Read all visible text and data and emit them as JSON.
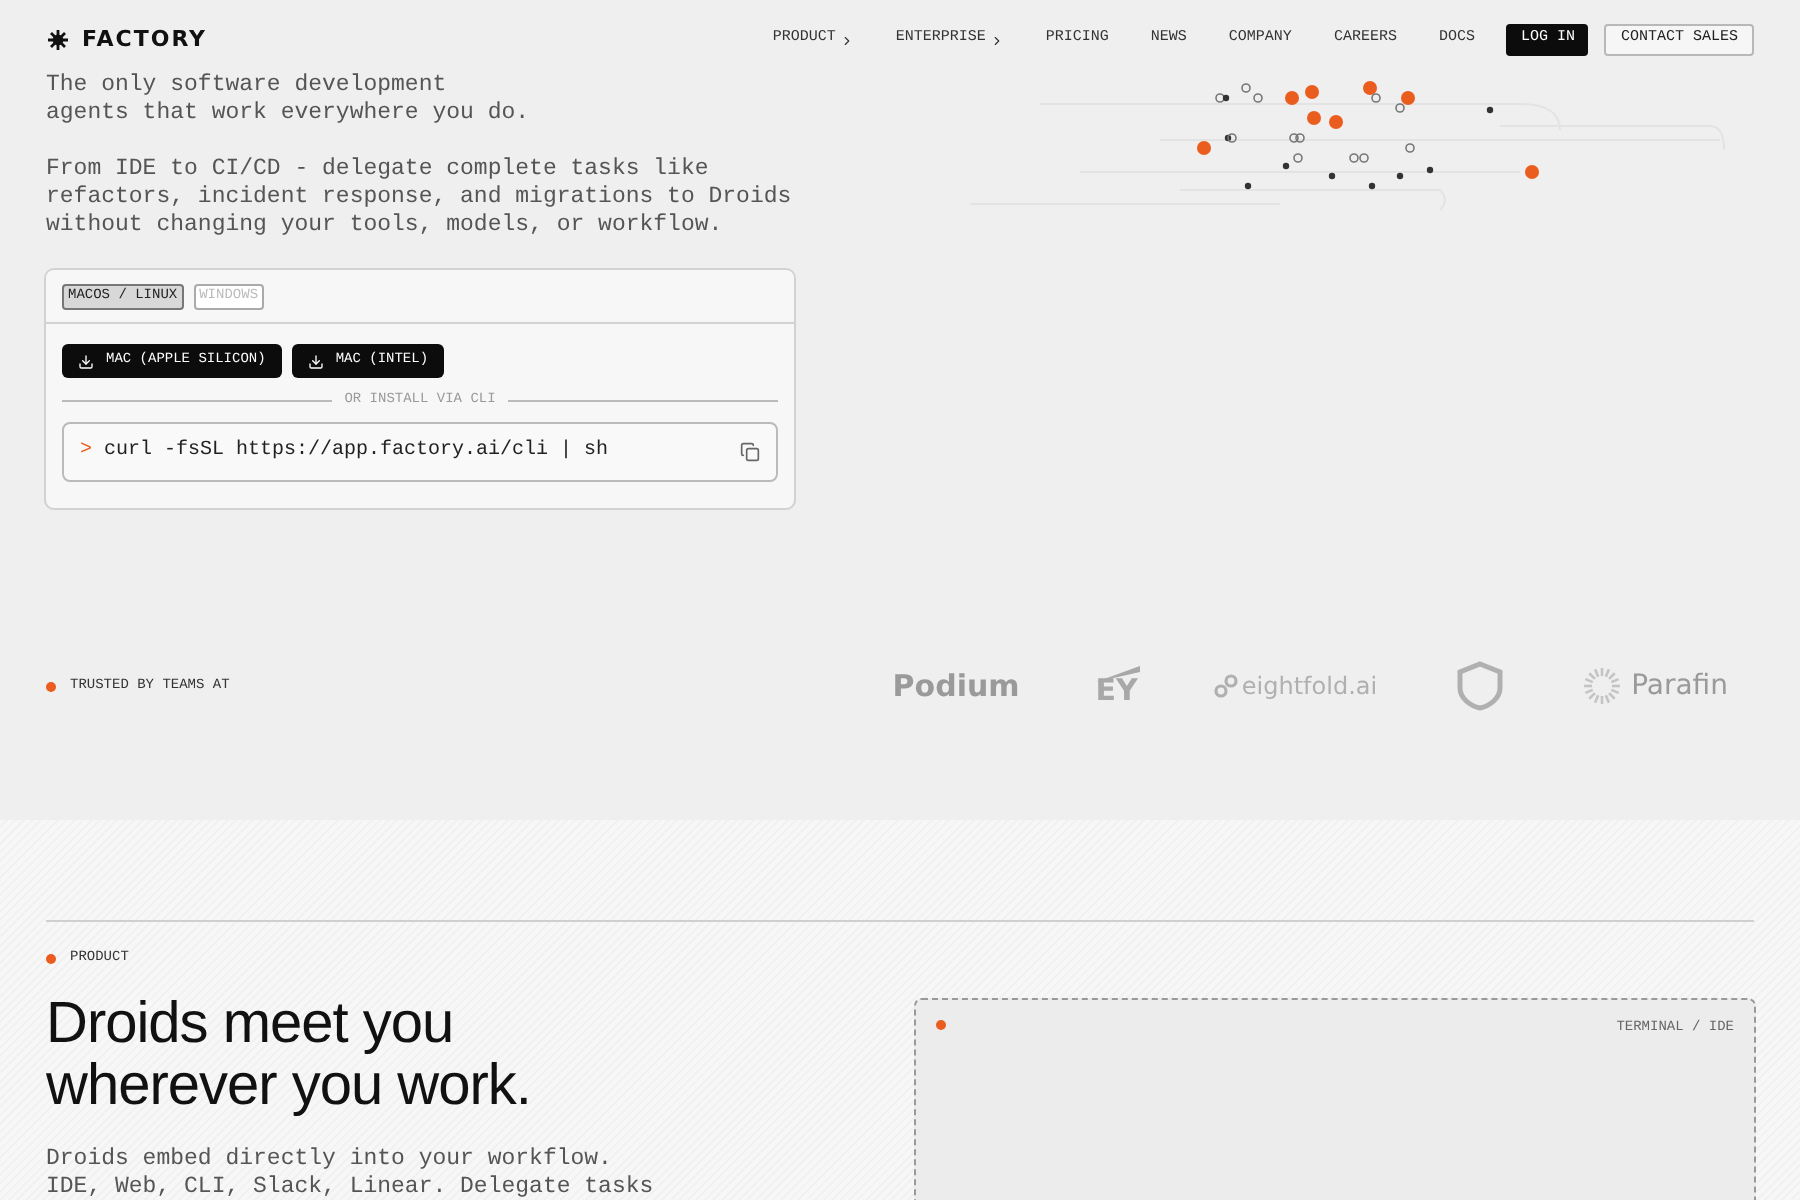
{
  "header": {
    "logo": "FACTORY",
    "nav": [
      {
        "label": "PRODUCT",
        "has_menu": true
      },
      {
        "label": "ENTERPRISE",
        "has_menu": true
      },
      {
        "label": "PRICING",
        "has_menu": false
      },
      {
        "label": "NEWS",
        "has_menu": false
      },
      {
        "label": "COMPANY",
        "has_menu": false
      },
      {
        "label": "CAREERS",
        "has_menu": false
      },
      {
        "label": "DOCS",
        "has_menu": false
      }
    ],
    "login": "LOG IN",
    "contact": "CONTACT SALES"
  },
  "hero": {
    "intro": [
      "The only software development",
      "agents that work everywhere you do."
    ],
    "description": [
      "From IDE to CI/CD - delegate complete tasks like",
      "refactors, incident response, and migrations to Droids",
      "without changing your tools, models, or workflow."
    ]
  },
  "install": {
    "tabs": [
      {
        "label": "MACOS / LINUX",
        "selected": true
      },
      {
        "label": "WINDOWS",
        "selected": false
      }
    ],
    "downloads": [
      "MAC (APPLE SILICON)",
      "MAC (INTEL)"
    ],
    "divider": "OR INSTALL VIA CLI",
    "prompt": ">",
    "command": "curl -fsSL https://app.factory.ai/cli | sh"
  },
  "trusted": {
    "label": "TRUSTED BY TEAMS AT",
    "logos": [
      {
        "kind": "wordmark",
        "text": "Podium"
      },
      {
        "kind": "ey",
        "text": "EY"
      },
      {
        "kind": "eightfold",
        "text": "eightfold.ai"
      },
      {
        "kind": "shield"
      },
      {
        "kind": "parafin",
        "text": "Parafin"
      }
    ]
  },
  "product": {
    "label": "PRODUCT",
    "title": [
      "Droids meet you",
      "wherever you work."
    ],
    "description": [
      "Droids embed directly into your workflow.",
      "IDE, Web, CLI, Slack, Linear. Delegate tasks"
    ],
    "panel": {
      "label": "TERMINAL / IDE"
    }
  }
}
